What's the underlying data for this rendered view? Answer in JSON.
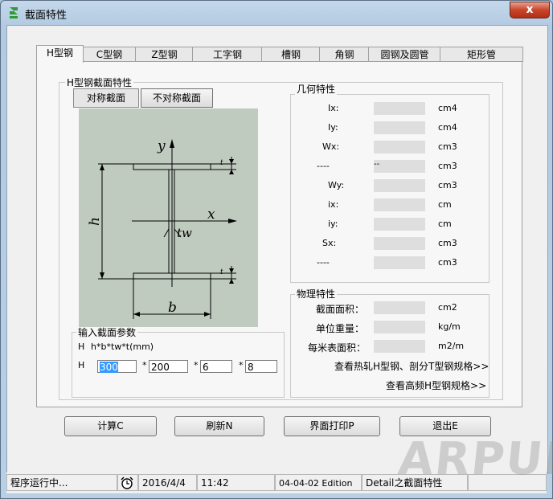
{
  "window": {
    "title": "截面特性",
    "close": "x"
  },
  "tabs": [
    "H型钢",
    "C型钢",
    "Z型钢",
    "工字钢",
    "槽钢",
    "角钢",
    "圆钢及圆管",
    "矩形管"
  ],
  "section": {
    "group_label": "H型钢截面特性",
    "seg_symmetric": "对称截面",
    "seg_asymmetric": "不对称截面",
    "drawing": {
      "y": "y",
      "x": "x",
      "h": "h",
      "tw": "tw",
      "t_top": "t",
      "t_bottom": "t",
      "b": "b"
    }
  },
  "input": {
    "group_label": "输入截面参数",
    "formula_prefix": "H",
    "formula": "h*b*tw*t(mm)",
    "row_prefix": "H",
    "star": "*",
    "h": "300",
    "b": "200",
    "tw": "6",
    "t": "8"
  },
  "geometry": {
    "group_label": "几何特性",
    "rows": [
      {
        "label": "Ix:",
        "value": "",
        "unit": "cm4"
      },
      {
        "label": "Iy:",
        "value": "",
        "unit": "cm4"
      },
      {
        "label": "Wx:",
        "value": "",
        "unit": "cm3"
      },
      {
        "label": "----",
        "value": "--",
        "unit": "cm3"
      },
      {
        "label": "Wy:",
        "value": "",
        "unit": "cm3"
      },
      {
        "label": "ix:",
        "value": "",
        "unit": "cm"
      },
      {
        "label": "iy:",
        "value": "",
        "unit": "cm"
      },
      {
        "label": "Sx:",
        "value": "",
        "unit": "cm3"
      },
      {
        "label": "----",
        "value": "",
        "unit": "cm3"
      }
    ]
  },
  "physical": {
    "group_label": "物理特性",
    "rows": [
      {
        "label": "截面面积：",
        "value": "",
        "unit": "cm2"
      },
      {
        "label": "单位重量：",
        "value": "",
        "unit": "kg/m"
      },
      {
        "label": "每米表面积：",
        "value": "",
        "unit": "m2/m"
      }
    ],
    "link1": "查看热轧H型钢、剖分T型钢规格>>",
    "link2": "查看高频H型钢规格>>"
  },
  "buttons": {
    "calc": "计算C",
    "refresh": "刷新N",
    "print": "界面打印P",
    "exit": "退出E"
  },
  "status": {
    "state": "程序运行中...",
    "date": "2016/4/4",
    "time": "11:42",
    "edition": "04-04-02 Edition",
    "module": "Detail之截面特性"
  },
  "watermark": "ARPUN"
}
